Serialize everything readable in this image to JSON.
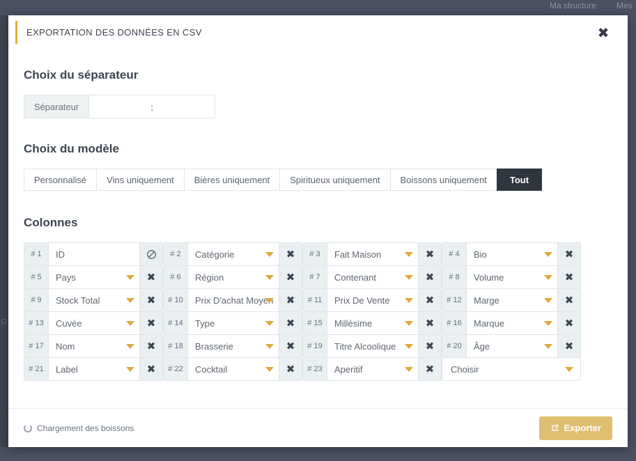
{
  "background": {
    "nav_links": [
      "Ma structure",
      "Mes"
    ],
    "left_letter": "R"
  },
  "modal": {
    "title": "EXPORTATION DES DONNÉES EN CSV",
    "close_icon": "close-icon",
    "accent_color": "#e0ac3f"
  },
  "separator_section": {
    "heading": "Choix du séparateur",
    "addon_label": "Séparateur",
    "value": ";",
    "placeholder": ";"
  },
  "model_section": {
    "heading": "Choix du modèle",
    "tabs": [
      {
        "label": "Personnalisé",
        "active": false
      },
      {
        "label": "Vins uniquement",
        "active": false
      },
      {
        "label": "Bières uniquement",
        "active": false
      },
      {
        "label": "Spiritueux uniquement",
        "active": false
      },
      {
        "label": "Boissons uniquement",
        "active": false
      },
      {
        "label": "Tout",
        "active": true
      }
    ]
  },
  "columns_section": {
    "heading": "Colonnes",
    "items": [
      {
        "num": "# 1",
        "value": "ID",
        "locked": true,
        "action_icon": "prohibited-icon"
      },
      {
        "num": "# 2",
        "value": "Catégorie",
        "locked": false,
        "action_icon": "remove-icon"
      },
      {
        "num": "# 3",
        "value": "Fait Maison",
        "locked": false,
        "action_icon": "remove-icon"
      },
      {
        "num": "# 4",
        "value": "Bio",
        "locked": false,
        "action_icon": "remove-icon"
      },
      {
        "num": "# 5",
        "value": "Pays",
        "locked": false,
        "action_icon": "remove-icon"
      },
      {
        "num": "# 6",
        "value": "Région",
        "locked": false,
        "action_icon": "remove-icon"
      },
      {
        "num": "# 7",
        "value": "Contenant",
        "locked": false,
        "action_icon": "remove-icon"
      },
      {
        "num": "# 8",
        "value": "Volume",
        "locked": false,
        "action_icon": "remove-icon"
      },
      {
        "num": "# 9",
        "value": "Stock Total",
        "locked": false,
        "action_icon": "remove-icon"
      },
      {
        "num": "# 10",
        "value": "Prix D'achat Moyen",
        "locked": false,
        "action_icon": "remove-icon"
      },
      {
        "num": "# 11",
        "value": "Prix De Vente",
        "locked": false,
        "action_icon": "remove-icon"
      },
      {
        "num": "# 12",
        "value": "Marge",
        "locked": false,
        "action_icon": "remove-icon"
      },
      {
        "num": "# 13",
        "value": "Cuvée",
        "locked": false,
        "action_icon": "remove-icon"
      },
      {
        "num": "# 14",
        "value": "Type",
        "locked": false,
        "action_icon": "remove-icon"
      },
      {
        "num": "# 15",
        "value": "Millésime",
        "locked": false,
        "action_icon": "remove-icon"
      },
      {
        "num": "# 16",
        "value": "Marque",
        "locked": false,
        "action_icon": "remove-icon"
      },
      {
        "num": "# 17",
        "value": "Nom",
        "locked": false,
        "action_icon": "remove-icon"
      },
      {
        "num": "# 18",
        "value": "Brasserie",
        "locked": false,
        "action_icon": "remove-icon"
      },
      {
        "num": "# 19",
        "value": "Titre Alcoolique",
        "locked": false,
        "action_icon": "remove-icon"
      },
      {
        "num": "# 20",
        "value": "Âge",
        "locked": false,
        "action_icon": "remove-icon"
      },
      {
        "num": "# 21",
        "value": "Label",
        "locked": false,
        "action_icon": "remove-icon"
      },
      {
        "num": "# 22",
        "value": "Cocktail",
        "locked": false,
        "action_icon": "remove-icon"
      },
      {
        "num": "# 23",
        "value": "Aperitif",
        "locked": false,
        "action_icon": "remove-icon"
      }
    ],
    "add_select_label": "Choisir"
  },
  "footer": {
    "loading_text": "Chargement des boissons",
    "export_label": "Exporter",
    "export_icon": "external-link-icon",
    "export_color": "#e0be71"
  }
}
